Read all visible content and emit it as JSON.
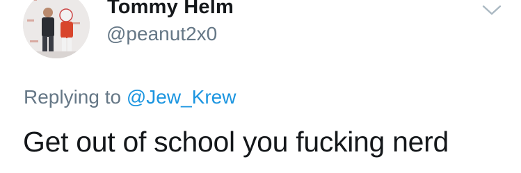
{
  "tweet": {
    "author": {
      "display_name": "Tommy Helm",
      "handle": "@peanut2x0",
      "avatar": "profile-photo"
    },
    "reply_context": {
      "prefix": "Replying to",
      "mention": "@Jew_Krew"
    },
    "text": "Get out of school you fucking nerd",
    "menu_icon": "chevron-down-icon"
  },
  "colors": {
    "text": "#14171a",
    "secondary": "#657786",
    "link": "#1b95e0",
    "background": "#ffffff"
  }
}
